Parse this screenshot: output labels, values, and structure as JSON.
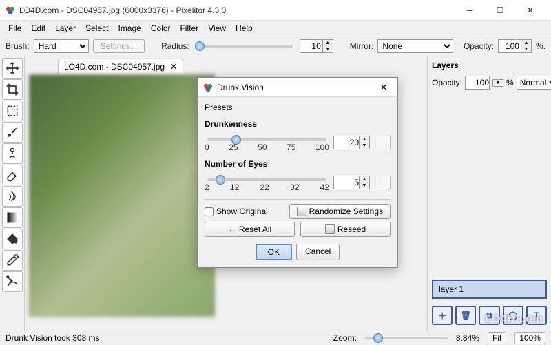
{
  "window": {
    "title": "LO4D.com - DSC04957.jpg (6000x3376) - Pixelitor 4.3.0"
  },
  "menu": [
    "File",
    "Edit",
    "Layer",
    "Select",
    "Image",
    "Color",
    "Filter",
    "View",
    "Help"
  ],
  "options": {
    "brush_label": "Brush:",
    "brush_value": "Hard",
    "settings_label": "Settings...",
    "radius_label": "Radius:",
    "radius_value": "10",
    "mirror_label": "Mirror:",
    "mirror_value": "None",
    "opacity_label": "Opacity:",
    "opacity_value": "100",
    "opacity_suffix": "%."
  },
  "tab": {
    "label": "LO4D.com - DSC04957.jpg"
  },
  "layers": {
    "heading": "Layers",
    "opacity_label": "Opacity:",
    "opacity_value": "100",
    "percent": "%",
    "blend_mode": "Normal",
    "layer1": "layer 1"
  },
  "dialog": {
    "title": "Drunk Vision",
    "presets": "Presets",
    "drunkenness": {
      "label": "Drunkenness",
      "ticks": [
        "0",
        "25",
        "50",
        "75",
        "100"
      ],
      "value": "20"
    },
    "eyes": {
      "label": "Number of Eyes",
      "ticks": [
        "2",
        "12",
        "22",
        "32",
        "42"
      ],
      "value": "5"
    },
    "show_original": "Show Original",
    "randomize": "Randomize Settings",
    "reset_all": "Reset All",
    "reseed": "Reseed",
    "ok": "OK",
    "cancel": "Cancel"
  },
  "status": {
    "message": "Drunk Vision took 308 ms",
    "zoom_label": "Zoom:",
    "zoom_pct": "8.84%",
    "fit": "Fit",
    "hundred": "100%"
  },
  "watermark": "LO4D.com"
}
